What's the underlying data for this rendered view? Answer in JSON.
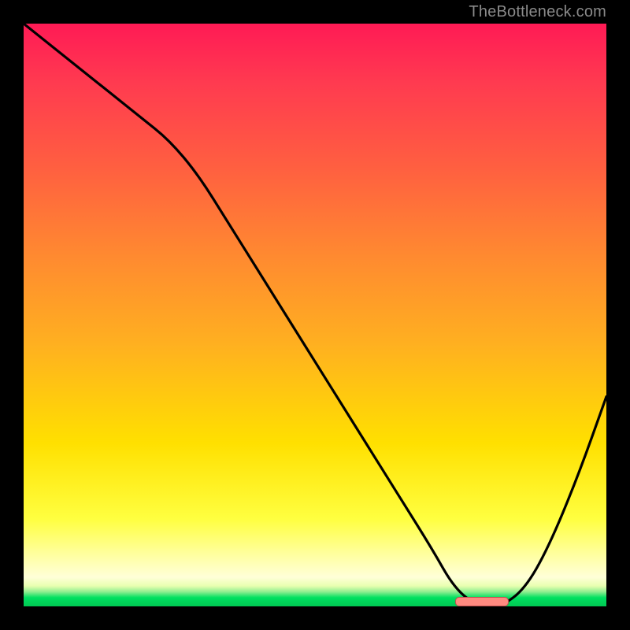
{
  "attribution": "TheBottleneck.com",
  "colors": {
    "frame": "#000000",
    "curve": "#000000",
    "notch_fill": "#ff8a80",
    "notch_border": "#c05050",
    "gradient_top": "#ff1a55",
    "gradient_bottom": "#00c853"
  },
  "chart_data": {
    "type": "line",
    "title": "",
    "xlabel": "",
    "ylabel": "",
    "xlim": [
      0,
      100
    ],
    "ylim": [
      0,
      100
    ],
    "x": [
      0,
      10,
      20,
      25,
      30,
      35,
      40,
      45,
      50,
      55,
      60,
      65,
      70,
      74,
      78,
      82,
      86,
      90,
      95,
      100
    ],
    "values": [
      100,
      92,
      84,
      80,
      74,
      66,
      58,
      50,
      42,
      34,
      26,
      18,
      10,
      3,
      0,
      0,
      3,
      10,
      22,
      36
    ],
    "notch_range_x": [
      74,
      83
    ],
    "grid": false,
    "legend": false
  }
}
